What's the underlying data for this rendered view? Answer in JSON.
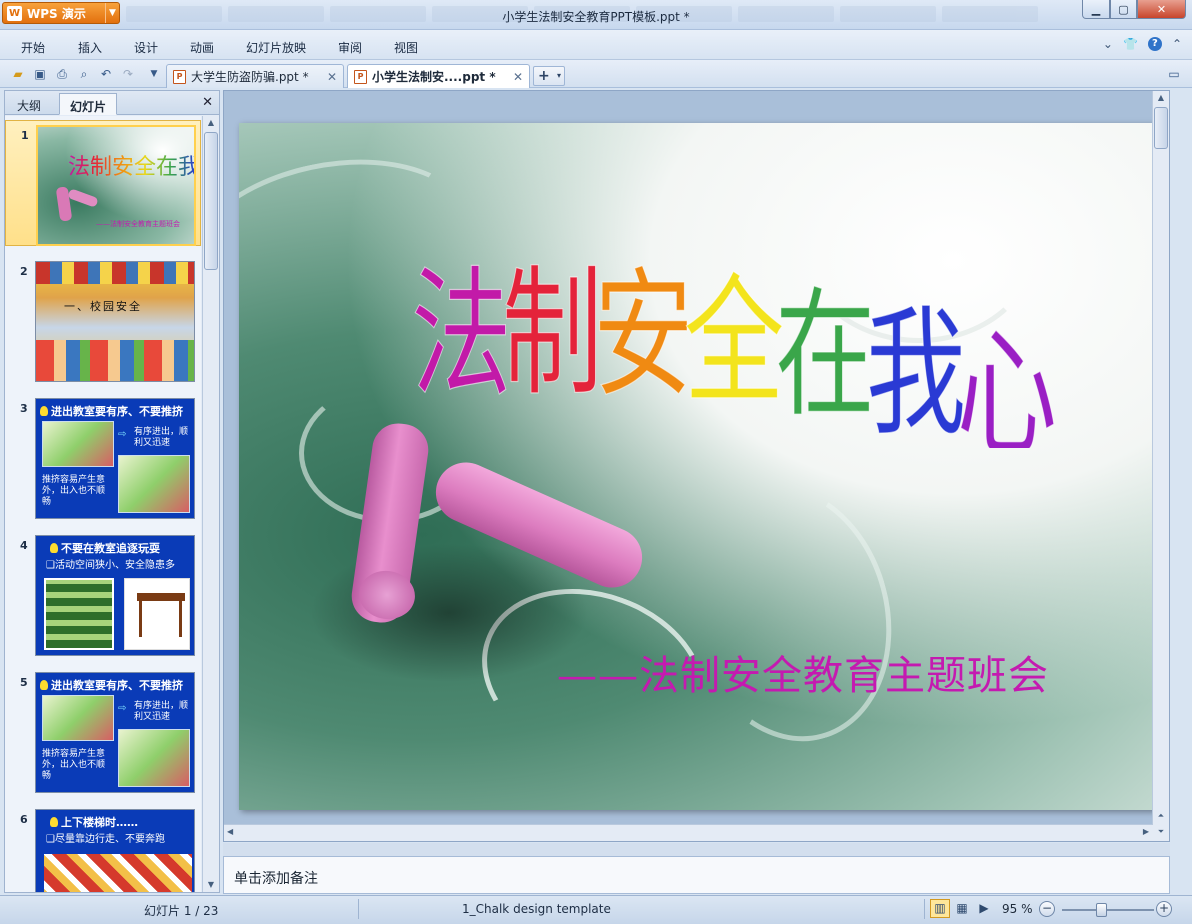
{
  "app": {
    "name": "WPS 演示",
    "window_title": "小学生法制安全教育PPT模板.ppt *"
  },
  "menu": [
    "开始",
    "插入",
    "设计",
    "动画",
    "幻灯片放映",
    "审阅",
    "视图"
  ],
  "doc_tabs": [
    {
      "label": "大学生防盗防骗.ppt *",
      "active": false
    },
    {
      "label": "小学生法制安....ppt *",
      "active": true
    }
  ],
  "left_panel": {
    "tabs": [
      "大纲",
      "幻灯片"
    ],
    "active_tab": "幻灯片",
    "slides": [
      {
        "num": "1",
        "title": "法制安全在我心",
        "subtitle": "——法制安全教育主题班会"
      },
      {
        "num": "2",
        "title": "一、校园安全"
      },
      {
        "num": "3",
        "title": "进出教室要有序、不要推挤",
        "right_text": "有序进出，顺利又迅速",
        "left_text": "推挤容易产生意外，出入也不顺畅"
      },
      {
        "num": "4",
        "title": "不要在教室追逐玩耍",
        "line2": "❑活动空间狭小、安全隐患多"
      },
      {
        "num": "5",
        "title": "进出教室要有序、不要推挤",
        "right_text": "有序进出，顺利又迅速",
        "left_text": "推挤容易产生意外，出入也不顺畅"
      },
      {
        "num": "6",
        "title": "上下楼梯时……",
        "line2": "❑尽量靠边行走、不要奔跑"
      }
    ]
  },
  "slide": {
    "title": "法制安全在我心",
    "subtitle": "——法制安全教育主题班会",
    "title_colors": [
      "#c21aa8",
      "#e4233a",
      "#f08a12",
      "#f3e41c",
      "#3aa64a",
      "#2a3ad4",
      "#9a1fc4"
    ]
  },
  "notes": {
    "placeholder": "单击添加备注"
  },
  "status": {
    "slide_counter": "幻灯片 1 / 23",
    "template": "1_Chalk design template",
    "zoom": "95 %"
  }
}
